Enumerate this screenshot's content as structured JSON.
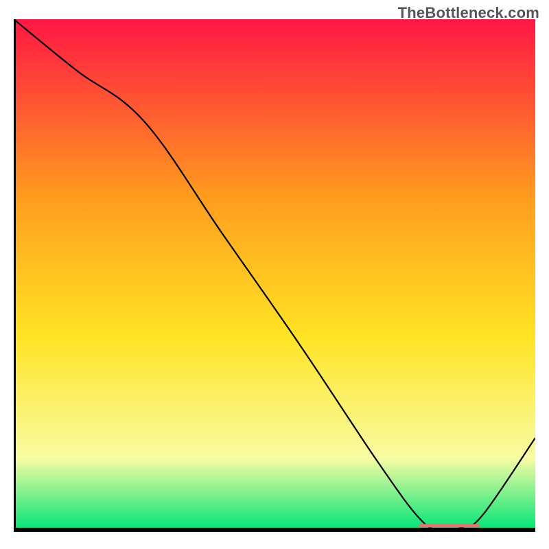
{
  "watermark": "TheBottleneck.com",
  "chart_data": {
    "type": "line",
    "title": "",
    "xlabel": "",
    "ylabel": "",
    "xlim": [
      0,
      100
    ],
    "ylim": [
      0,
      100
    ],
    "grid": false,
    "legend": false,
    "gradient_colors": {
      "top": "#ff1744",
      "upper_mid": "#ff9d1e",
      "mid": "#ffe324",
      "lower_mid": "#f8fca3",
      "bottom": "#00e576"
    },
    "series": [
      {
        "name": "bottleneck_curve",
        "x": [
          0,
          12,
          25,
          40,
          55,
          70,
          78,
          82,
          86,
          90,
          100
        ],
        "y": [
          100,
          90,
          80,
          58,
          36,
          13,
          2,
          0,
          0.5,
          3,
          18
        ]
      }
    ],
    "flat_segment": {
      "label": "",
      "color": "#ef6e6e",
      "x_start": 78,
      "x_end": 89,
      "y": 0.8,
      "thickness": 5
    }
  }
}
